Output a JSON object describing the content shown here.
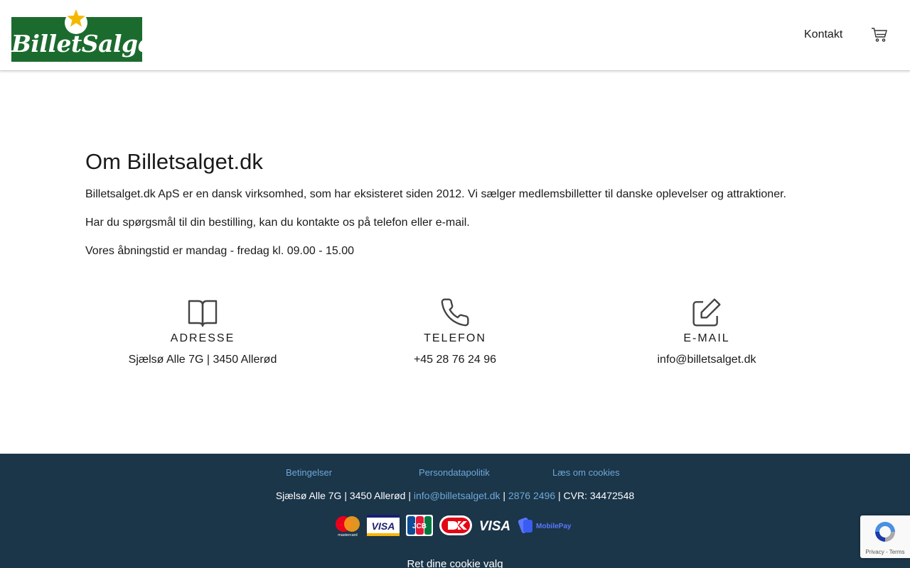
{
  "header": {
    "logo_text": "BilletSalget",
    "nav_contact": "Kontakt"
  },
  "main": {
    "title": "Om Billetsalget.dk",
    "paragraphs": [
      "Billetsalget.dk ApS er en dansk virksomhed, som har eksisteret siden 2012. Vi sælger medlemsbilletter til danske oplevelser og attraktioner.",
      "Har du spørgsmål til din bestilling, kan du kontakte os på telefon eller e-mail.",
      "Vores åbningstid er mandag - fredag kl. 09.00 - 15.00"
    ],
    "info": [
      {
        "icon": "book-icon",
        "heading": "ADRESSE",
        "value": "Sjælsø Alle 7G | 3450 Allerød"
      },
      {
        "icon": "phone-icon",
        "heading": "TELEFON",
        "value": "+45 28 76 24 96"
      },
      {
        "icon": "edit-icon",
        "heading": "E-MAIL",
        "value": "info@billetsalget.dk"
      }
    ]
  },
  "footer": {
    "links": [
      "Betingelser",
      "Persondatapolitik",
      "Læs om cookies"
    ],
    "address_prefix": "Sjælsø Alle 7G | 3450 Allerød |",
    "email": "info@billetsalget.dk",
    "separator": "|",
    "phone": "2876 2496",
    "cvr": "| CVR: 34472548",
    "payment_methods": [
      "mastercard-icon",
      "visa-icon",
      "jcb-icon",
      "dankort-icon",
      "visa-electron-icon",
      "mobilepay-icon"
    ],
    "payment_labels": {
      "visa": "VISA",
      "jcb": "JCB",
      "visa2": "VISA",
      "mobilepay": "MobilePay",
      "mastercard": "mastercard"
    },
    "cookie_settings": "Ret dine cookie valg"
  },
  "recaptcha": {
    "terms": "Privacy - Terms"
  },
  "colors": {
    "brand_green": "#1c6b2e",
    "star": "#f5b800",
    "footer_bg": "#1b3549",
    "link": "#6ea8d8"
  }
}
